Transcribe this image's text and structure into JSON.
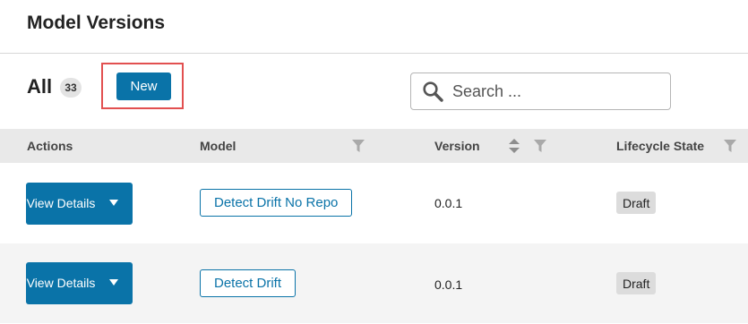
{
  "header": {
    "title": "Model Versions"
  },
  "toolbar": {
    "all_label": "All",
    "count": "33",
    "new_label": "New",
    "search_placeholder": "Search ..."
  },
  "table": {
    "columns": {
      "actions": "Actions",
      "model": "Model",
      "version": "Version",
      "lifecycle": "Lifecycle State"
    },
    "rows": [
      {
        "action_label": "View Details",
        "model": "Detect Drift No Repo",
        "version": "0.0.1",
        "state": "Draft"
      },
      {
        "action_label": "View Details",
        "model": "Detect Drift",
        "version": "0.0.1",
        "state": "Draft"
      }
    ]
  },
  "colors": {
    "accent": "#0a73a8",
    "highlight": "#e25050",
    "header_bg": "#e9e9e9",
    "alt_row_bg": "#f4f4f4"
  },
  "icons": [
    "search-icon",
    "filter-icon",
    "sort-icon",
    "chevron-down-icon"
  ]
}
